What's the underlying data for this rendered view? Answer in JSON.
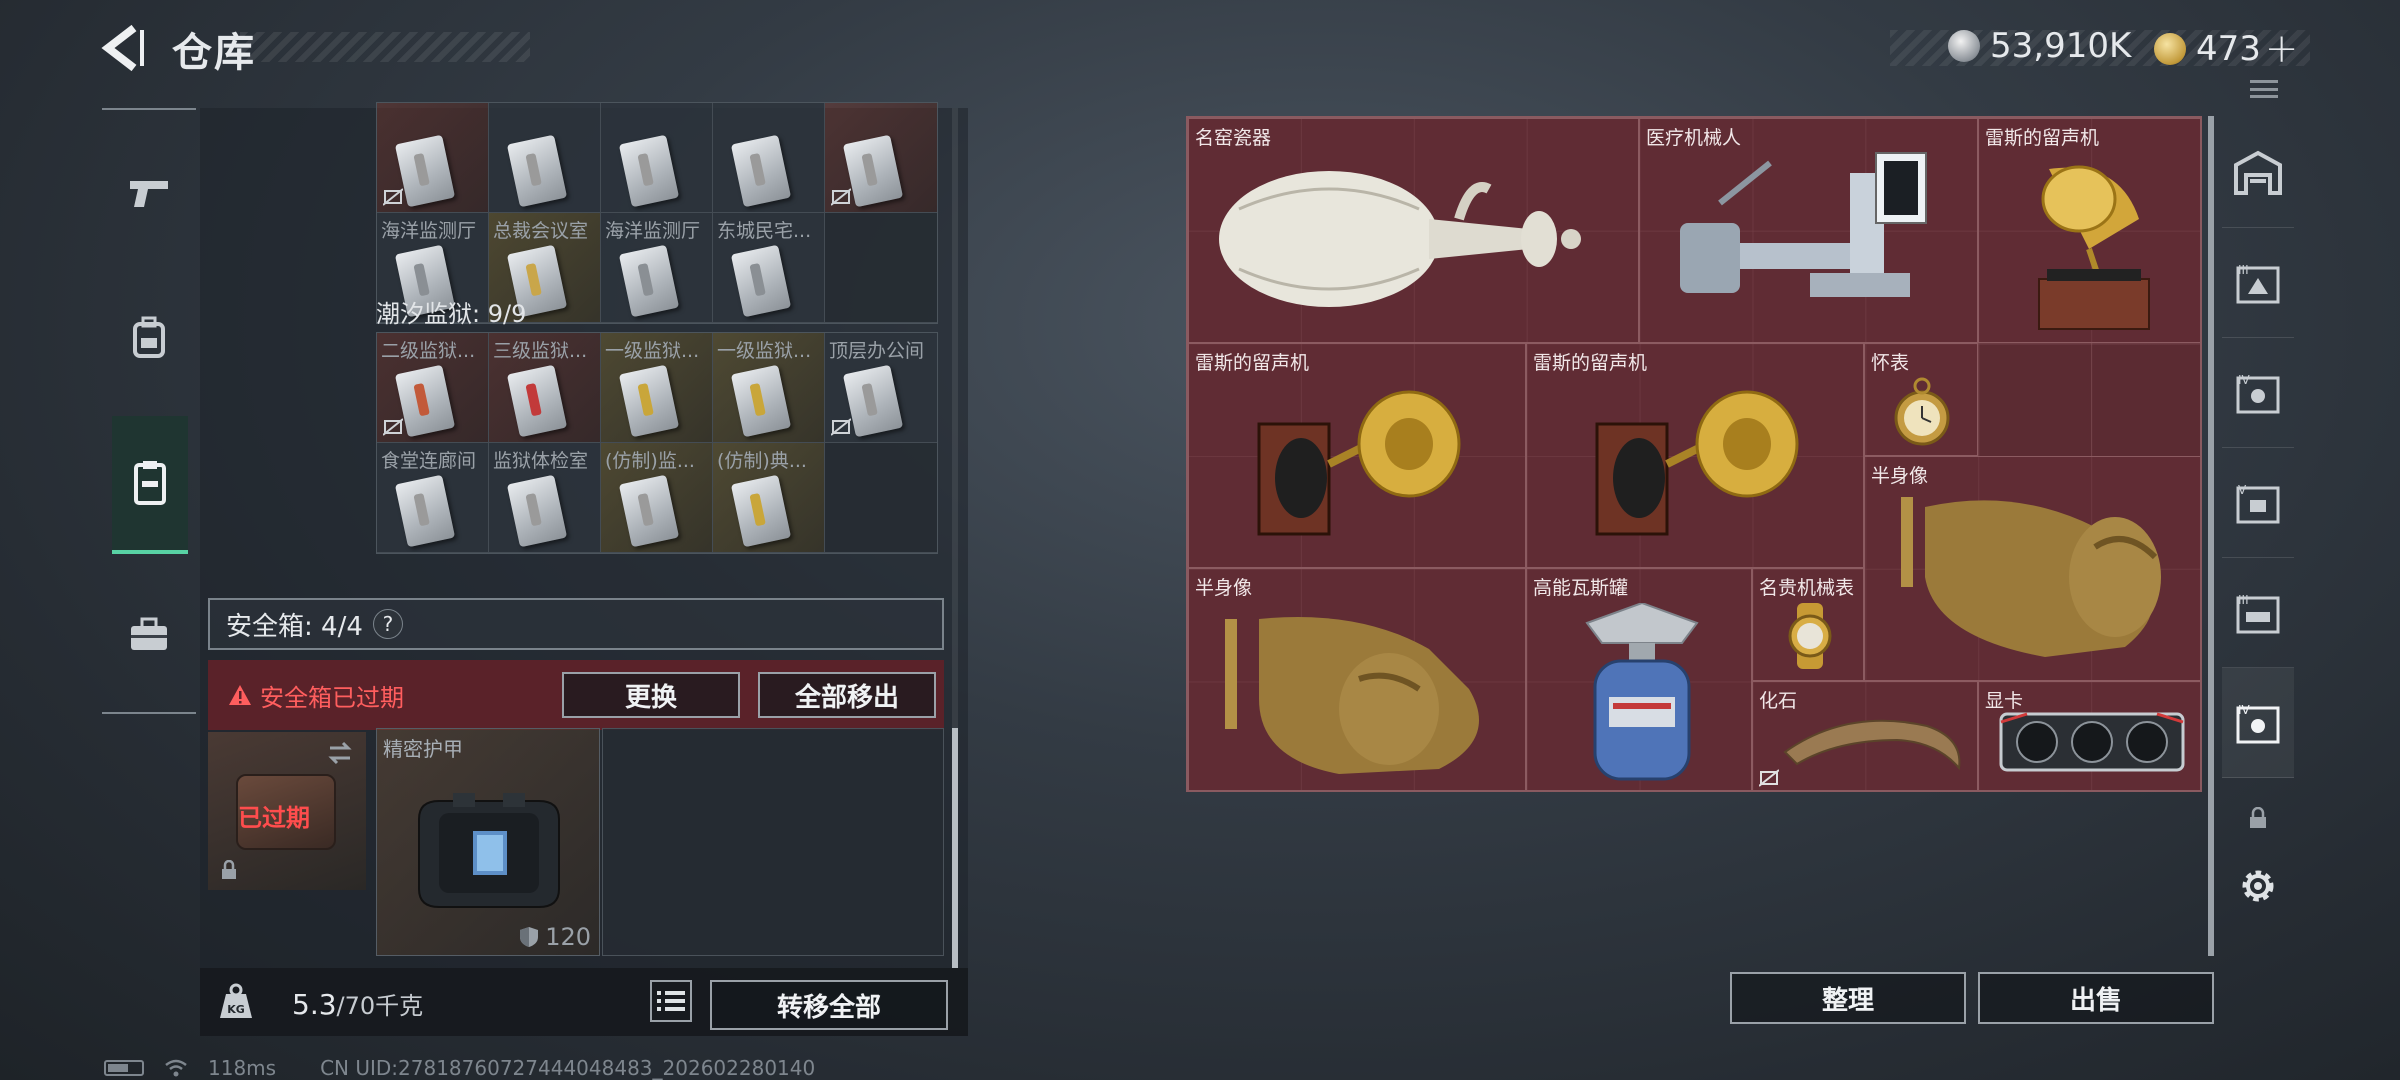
{
  "header": {
    "title": "仓库",
    "currency_silver": "53,910K",
    "currency_gold": "473",
    "plus_label": "+"
  },
  "left_rail": {
    "items": [
      {
        "name": "weapons",
        "icon": "pistol-icon"
      },
      {
        "name": "equipment",
        "icon": "backpack-icon"
      },
      {
        "name": "collectibles",
        "icon": "keycard-case-icon",
        "active": true
      },
      {
        "name": "consumables",
        "icon": "toolbox-icon"
      }
    ]
  },
  "key_section_1": {
    "row1": [
      {
        "label": "",
        "tint": "red",
        "stripe": "#9a9a9a",
        "no_sell": true
      },
      {
        "label": "",
        "tint": "",
        "stripe": "#9a9a9a"
      },
      {
        "label": "",
        "tint": "",
        "stripe": "#9a9a9a"
      },
      {
        "label": "",
        "tint": "",
        "stripe": "#9a9a9a"
      },
      {
        "label": "",
        "tint": "red",
        "stripe": "#9a9a9a",
        "no_sell": true
      }
    ],
    "row2": [
      {
        "label": "海洋监测厅",
        "tint": "",
        "stripe": "#8a8f94"
      },
      {
        "label": "总裁会议室",
        "tint": "yel",
        "stripe": "#c9a64a"
      },
      {
        "label": "海洋监测厅",
        "tint": "",
        "stripe": "#8a8f94"
      },
      {
        "label": "东城民宅...",
        "tint": "",
        "stripe": "#8a8f94"
      },
      {
        "label": "",
        "tint": "empty"
      }
    ]
  },
  "prison_section": {
    "title": "潮汐监狱: 9/9",
    "row1": [
      {
        "label": "二级监狱...",
        "tint": "red",
        "stripe": "#c25a3a",
        "no_sell": true
      },
      {
        "label": "三级监狱...",
        "tint": "red",
        "stripe": "#c23a3a"
      },
      {
        "label": "一级监狱...",
        "tint": "yel",
        "stripe": "#c9a63a"
      },
      {
        "label": "一级监狱...",
        "tint": "yel",
        "stripe": "#c9a63a"
      },
      {
        "label": "顶层办公间",
        "tint": "",
        "stripe": "#9a9a9a",
        "no_sell": true
      }
    ],
    "row2": [
      {
        "label": "食堂连廊间",
        "tint": "",
        "stripe": "#9a9a9a"
      },
      {
        "label": "监狱体检室",
        "tint": "",
        "stripe": "#9a9a9a"
      },
      {
        "label": "(仿制)监...",
        "tint": "yel",
        "stripe": "#9a9a9a"
      },
      {
        "label": "(仿制)典...",
        "tint": "yel",
        "stripe": "#c9a63a"
      },
      {
        "label": "",
        "tint": "empty"
      }
    ]
  },
  "safe_box": {
    "label": "安全箱: 4/4",
    "help": "?",
    "expired_message": "安全箱已过期",
    "replace_button": "更换",
    "remove_all_button": "全部移出",
    "case_tag": "已过期",
    "armor_label": "精密护甲",
    "armor_durability": "120"
  },
  "bottom_bar": {
    "weight_current": "5.3",
    "weight_max": "/70千克",
    "weight_icon_label": "KG",
    "transfer_all_button": "转移全部"
  },
  "stash": {
    "items": [
      {
        "key": "vase",
        "label": "名窑瓷器"
      },
      {
        "key": "robot",
        "label": "医疗机械人"
      },
      {
        "key": "gramophone1",
        "label": "雷斯的留声机"
      },
      {
        "key": "gramophone2",
        "label": "雷斯的留声机"
      },
      {
        "key": "gramophone3",
        "label": "雷斯的留声机"
      },
      {
        "key": "pocket_watch",
        "label": "怀表"
      },
      {
        "key": "bust1",
        "label": "半身像"
      },
      {
        "key": "bust2",
        "label": "半身像"
      },
      {
        "key": "gas_tank",
        "label": "高能瓦斯罐"
      },
      {
        "key": "wrist_watch",
        "label": "名贵机械表"
      },
      {
        "key": "fossil",
        "label": "化石"
      },
      {
        "key": "gpu",
        "label": "显卡"
      }
    ],
    "sort_button": "整理",
    "sell_button": "出售"
  },
  "right_rail": {
    "items": [
      {
        "name": "stash-main",
        "icon": "warehouse-icon"
      },
      {
        "name": "stash-3",
        "icon": "stash-tab-icon",
        "roman": "III"
      },
      {
        "name": "stash-4",
        "icon": "stash-tab-icon",
        "roman": "IV"
      },
      {
        "name": "stash-5",
        "icon": "stash-tab-icon",
        "roman": "V"
      },
      {
        "name": "stash-3b",
        "icon": "stash-tab-icon",
        "roman": "III"
      },
      {
        "name": "stash-4b",
        "icon": "stash-tab-icon",
        "roman": "IV",
        "active": true
      }
    ]
  },
  "footer": {
    "ping": "118ms",
    "uid": "CN UID:27818760727444048483_202602280140"
  },
  "colors": {
    "accent_green": "#58d2a4",
    "warning_red": "#ff5e5e",
    "stash_bg": "#5b2b32"
  }
}
